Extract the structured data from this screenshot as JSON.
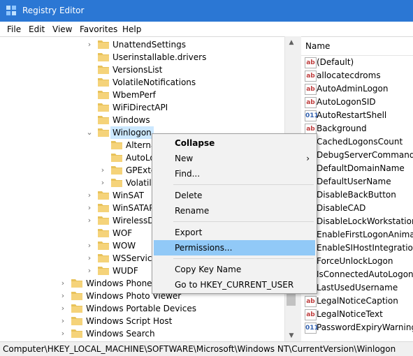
{
  "window": {
    "title": "Registry Editor",
    "app_icon": "registry-icon"
  },
  "menubar": {
    "items": [
      "File",
      "Edit",
      "View",
      "Favorites",
      "Help"
    ]
  },
  "tree": {
    "items": [
      {
        "label": "UnattendSettings",
        "expander": "collapsed"
      },
      {
        "label": "Userinstallable.drivers",
        "expander": "none"
      },
      {
        "label": "VersionsList",
        "expander": "none"
      },
      {
        "label": "VolatileNotifications",
        "expander": "none"
      },
      {
        "label": "WbemPerf",
        "expander": "none"
      },
      {
        "label": "WiFiDirectAPI",
        "expander": "none"
      },
      {
        "label": "Windows",
        "expander": "none"
      },
      {
        "label": "Winlogon",
        "expander": "expanded",
        "selected": true
      },
      {
        "label": "AlternateShells",
        "expander": "none",
        "child": true
      },
      {
        "label": "AutoLogonChecked",
        "expander": "none",
        "child": true
      },
      {
        "label": "GPExtensions",
        "expander": "collapsed",
        "child": true
      },
      {
        "label": "VolatileUserMgrKey",
        "expander": "collapsed",
        "child": true
      },
      {
        "label": "WinSAT",
        "expander": "collapsed"
      },
      {
        "label": "WinSATAPI",
        "expander": "collapsed"
      },
      {
        "label": "WirelessDocking",
        "expander": "collapsed"
      },
      {
        "label": "WOF",
        "expander": "none"
      },
      {
        "label": "WOW",
        "expander": "collapsed"
      },
      {
        "label": "WSService",
        "expander": "collapsed"
      },
      {
        "label": "WUDF",
        "expander": "collapsed"
      },
      {
        "label": "Windows Phone",
        "expander": "collapsed",
        "outer": true
      },
      {
        "label": "Windows Photo Viewer",
        "expander": "collapsed",
        "outer": true
      },
      {
        "label": "Windows Portable Devices",
        "expander": "collapsed",
        "outer": true
      },
      {
        "label": "Windows Script Host",
        "expander": "collapsed",
        "outer": true
      },
      {
        "label": "Windows Search",
        "expander": "collapsed",
        "outer": true
      }
    ]
  },
  "values": {
    "column_name": "Name",
    "items": [
      {
        "name": "(Default)",
        "type": "ab"
      },
      {
        "name": "allocatecdroms",
        "type": "ab"
      },
      {
        "name": "AutoAdminLogon",
        "type": "ab"
      },
      {
        "name": "AutoLogonSID",
        "type": "ab"
      },
      {
        "name": "AutoRestartShell",
        "type": "bin"
      },
      {
        "name": "Background",
        "type": "ab"
      },
      {
        "name": "CachedLogonsCount",
        "type": "ab"
      },
      {
        "name": "DebugServerCommand",
        "type": "ab"
      },
      {
        "name": "DefaultDomainName",
        "type": "ab"
      },
      {
        "name": "DefaultUserName",
        "type": "ab"
      },
      {
        "name": "DisableBackButton",
        "type": "bin"
      },
      {
        "name": "DisableCAD",
        "type": "bin"
      },
      {
        "name": "DisableLockWorkstation",
        "type": "bin"
      },
      {
        "name": "EnableFirstLogonAnimation",
        "type": "bin"
      },
      {
        "name": "EnableSIHostIntegration",
        "type": "bin"
      },
      {
        "name": "ForceUnlockLogon",
        "type": "bin"
      },
      {
        "name": "IsConnectedAutoLogon",
        "type": "bin"
      },
      {
        "name": "LastUsedUsername",
        "type": "ab"
      },
      {
        "name": "LegalNoticeCaption",
        "type": "ab"
      },
      {
        "name": "LegalNoticeText",
        "type": "ab"
      },
      {
        "name": "PasswordExpiryWarning",
        "type": "bin"
      }
    ]
  },
  "context_menu": {
    "items": [
      {
        "label": "Collapse",
        "bold": true
      },
      {
        "label": "New",
        "submenu": true
      },
      {
        "label": "Find..."
      },
      {
        "separator": true
      },
      {
        "label": "Delete"
      },
      {
        "label": "Rename"
      },
      {
        "separator": true
      },
      {
        "label": "Export"
      },
      {
        "label": "Permissions...",
        "highlighted": true
      },
      {
        "separator": true
      },
      {
        "label": "Copy Key Name"
      },
      {
        "label": "Go to HKEY_CURRENT_USER"
      }
    ]
  },
  "statusbar": {
    "path": "Computer\\HKEY_LOCAL_MACHINE\\SOFTWARE\\Microsoft\\Windows NT\\CurrentVersion\\Winlogon"
  },
  "colors": {
    "titlebar": "#2b77d4",
    "selection": "#cce8ff",
    "menu_highlight": "#91c9f7",
    "folder": "#e8c25a"
  }
}
